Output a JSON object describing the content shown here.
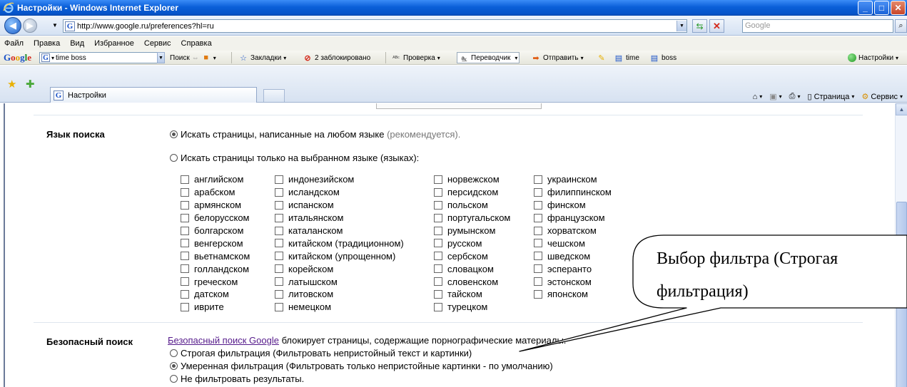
{
  "window": {
    "title": "Настройки - Windows Internet Explorer",
    "buttons": {
      "minimize": "_",
      "maximize": "□",
      "close": "✕"
    }
  },
  "address_bar": {
    "url": "http://www.google.ru/preferences?hl=ru",
    "search_placeholder": "Google"
  },
  "menu": [
    "Файл",
    "Правка",
    "Вид",
    "Избранное",
    "Сервис",
    "Справка"
  ],
  "google_toolbar": {
    "logo": [
      "G",
      "o",
      "o",
      "g",
      "l",
      "e"
    ],
    "search_value": "time boss",
    "search_label": "Поиск",
    "bookmarks": "Закладки",
    "blocked": "2 заблокировано",
    "spellcheck": "Проверка",
    "translate": "Переводчик",
    "send": "Отправить",
    "bm1": "time",
    "bm2": "boss",
    "settings": "Настройки"
  },
  "tabs": {
    "active_label": "Настройки",
    "commands": {
      "page": "Страница",
      "tools": "Сервис"
    }
  },
  "content": {
    "search_language": {
      "label": "Язык поиска",
      "option_any": "Искать страницы, написанные на любом языке",
      "option_any_note": "(рекомендуется).",
      "option_selected": "Искать страницы только на выбранном языке (языках):"
    },
    "languages": [
      [
        "английском",
        "арабском",
        "армянском",
        "белорусском",
        "болгарском",
        "венгерском",
        "вьетнамском",
        "голландском",
        "греческом",
        "датском",
        "иврите"
      ],
      [
        "индонезийском",
        "исландском",
        "испанском",
        "итальянском",
        "каталанском",
        "китайском (традиционном)",
        "китайском (упрощенном)",
        "корейском",
        "латышском",
        "литовском",
        "немецком"
      ],
      [
        "норвежском",
        "персидском",
        "польском",
        "португальском",
        "румынском",
        "русском",
        "сербском",
        "словацком",
        "словенском",
        "тайском",
        "турецком"
      ],
      [
        "украинском",
        "филиппинском",
        "финском",
        "французском",
        "хорватском",
        "чешском",
        "шведском",
        "эсперанто",
        "эстонском",
        "японском"
      ]
    ],
    "safe_search": {
      "label": "Безопасный поиск",
      "link": "Безопасный поиск Google",
      "description": "блокирует страницы, содержащие порнографические материалы.",
      "options": [
        "Строгая фильтрация (Фильтровать непристойный текст и картинки)",
        "Умеренная фильтрация (Фильтровать только непристойные картинки - по умолчанию)",
        "Не фильтровать результаты."
      ],
      "selected_index": 1
    }
  },
  "callout": {
    "line1": "Выбор фильтра (Строгая",
    "line2": "фильтрация)"
  },
  "colors": {
    "titlebar": "#0a5fd8",
    "link": "#551a8b",
    "note_gray": "#777777"
  }
}
